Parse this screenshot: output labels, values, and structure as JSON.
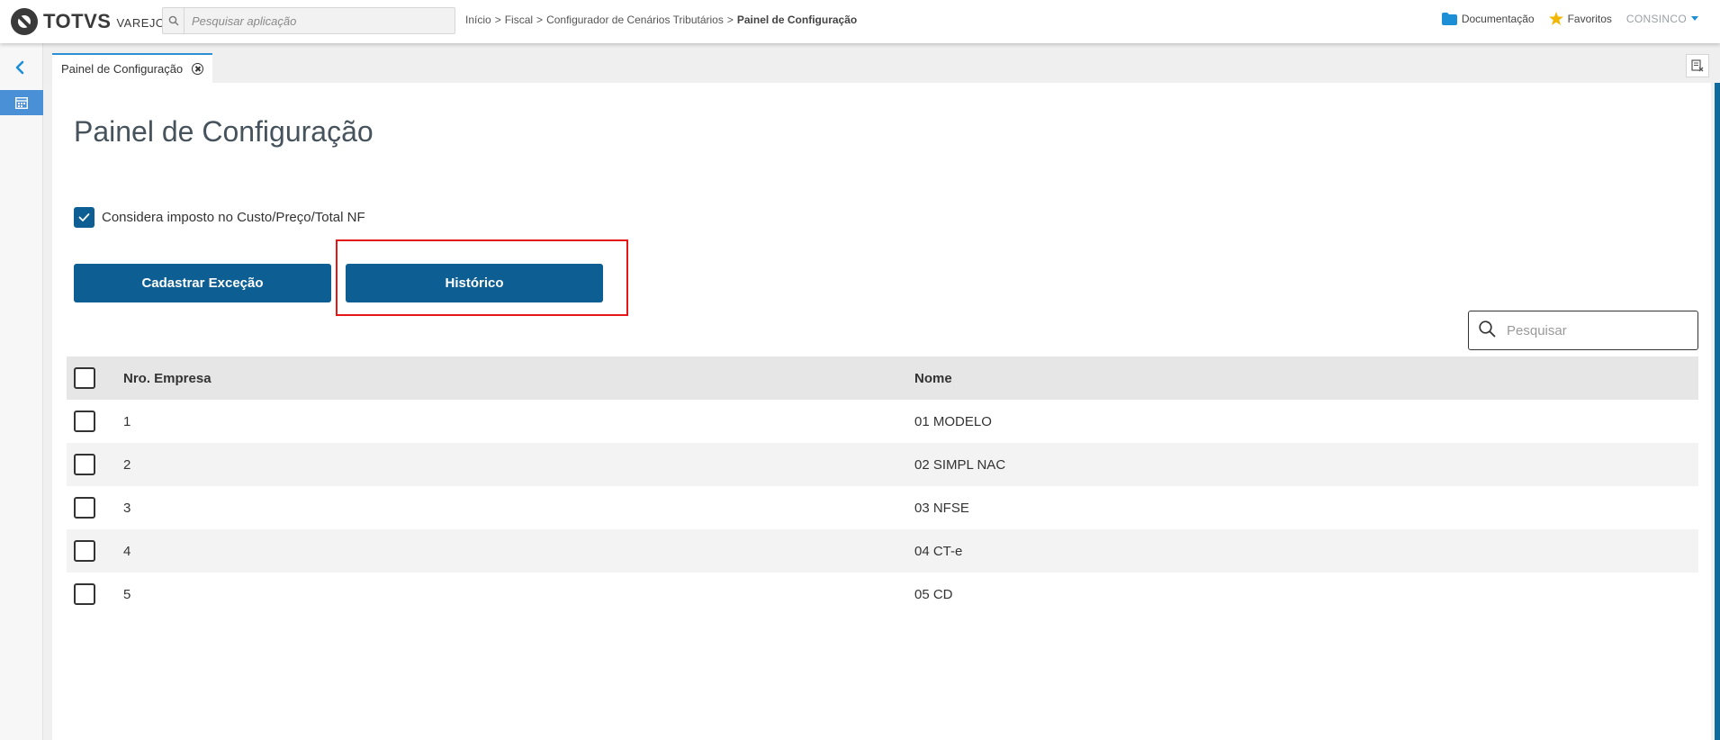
{
  "header": {
    "brand": "TOTVS",
    "brand_sub": "VAREJO",
    "search_placeholder": "Pesquisar aplicação",
    "breadcrumb": [
      "Início",
      ">",
      "Fiscal",
      ">",
      "Configurador de Cenários Tributários",
      ">",
      "Painel de Configuração"
    ],
    "documentation": "Documentação",
    "favorites": "Favoritos",
    "user": "CONSINCO"
  },
  "tab": {
    "label": "Painel de Configuração"
  },
  "page": {
    "title": "Painel de Configuração",
    "checkbox_label": "Considera imposto no Custo/Preço/Total NF",
    "checkbox_checked": true,
    "btn_cadastrar": "Cadastrar Exceção",
    "btn_historico": "Histórico",
    "grid_search_placeholder": "Pesquisar"
  },
  "table": {
    "columns": [
      "Nro. Empresa",
      "Nome"
    ],
    "rows": [
      {
        "nro": "1",
        "nome": "01 MODELO"
      },
      {
        "nro": "2",
        "nome": "02 SIMPL NAC"
      },
      {
        "nro": "3",
        "nome": "03 NFSE"
      },
      {
        "nro": "4",
        "nome": "04 CT-e"
      },
      {
        "nro": "5",
        "nome": "05 CD"
      }
    ]
  },
  "colors": {
    "primary": "#0d5e92",
    "accent": "#2d8ed3",
    "highlight": "#e41616"
  }
}
